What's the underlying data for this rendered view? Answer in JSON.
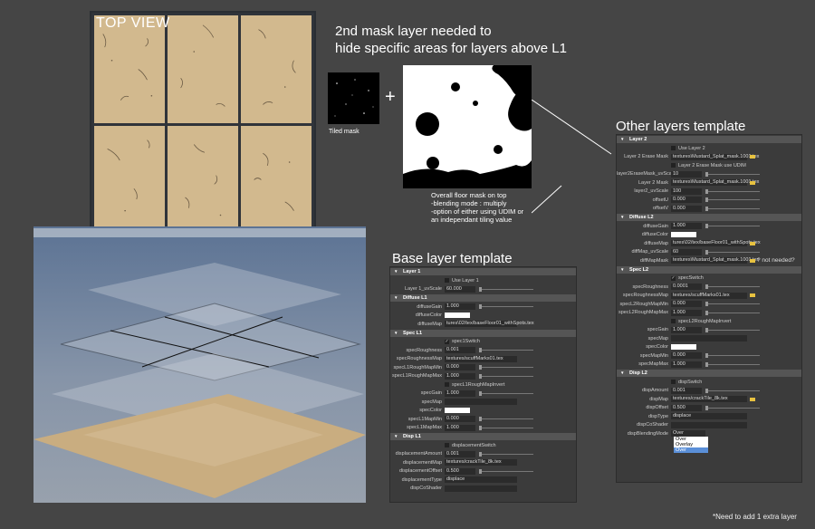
{
  "top_view": {
    "title": "TOP VIEW"
  },
  "mask_heading": {
    "line1": "2nd mask layer needed to",
    "line2": "hide specific areas for layers above L1"
  },
  "tiled_mask_label": "Tiled mask",
  "plus_sign": "+",
  "floor_caption": {
    "line1": "Overall floor mask on top",
    "line2": "-blending mode : multiply",
    "line3": "-option of either using UDIM or",
    "line4": "an independant tiling value"
  },
  "base_template": {
    "title": "Base layer template",
    "sections": [
      {
        "header": "Layer 1",
        "use_label": "Use Layer 1",
        "uv_label": "Layer 1_uvScale",
        "uv_value": "60.000"
      },
      {
        "header": "Diffuse L1",
        "gain_label": "diffuseGain",
        "gain_value": "1.000",
        "color_label": "diffuseColor",
        "map_label": "diffuseMap",
        "map_value": "tures\\02/tex/baseFloor01_withSpots.tex"
      },
      {
        "header": "Spec L1",
        "switch_label": "spec1Switch",
        "rough_label": "specRoughness",
        "rough_value": "0.001",
        "roughmap_label": "specRoughnessMap",
        "roughmap_value": "textures/scuffMarks01.tex",
        "rmin_label": "specL1RoughMapMin",
        "rmin_value": "0.000",
        "rmax_label": "specL1RoughMapMax",
        "rmax_value": "1.000",
        "invert_label": "specL1RoughMapInvert",
        "gain_label": "specGain",
        "gain_value": "1.000",
        "map_label": "specMap",
        "color_label": "specColor",
        "mmin_label": "specL1MapMin",
        "mmin_value": "0.000",
        "mmax_label": "specL1MapMax",
        "mmax_value": "1.000"
      },
      {
        "header": "Disp L1",
        "switch_label": "displacementSwitch",
        "amount_label": "displacementAmount",
        "amount_value": "0.001",
        "map_label": "displacementMap",
        "map_value": "textures/crackTile_8k.tex",
        "offset_label": "displacementOffset",
        "offset_value": "0.500",
        "type_label": "displacementType",
        "type_value": "displace",
        "shader_label": "dispCoShader"
      }
    ]
  },
  "other_template": {
    "title": "Other layers template",
    "layer": {
      "header": "Layer 2",
      "use_label": "Use Layer 2",
      "erase_label": "Layer 2 Erase Mask",
      "erase_value": "textures\\Mustard_Splat_mask.1001.tex",
      "udim_label": "Layer 2 Erase Mask use UDIM",
      "uv_label": "layer2EraseMask_uvScale",
      "uv_value": "10",
      "map_label": "Layer 2 Mask",
      "map_value": "textures\\Mustard_Splat_mask.1001.tex",
      "uvs_label": "layer2_uvScale",
      "uvs_value": "100",
      "ou_label": "offsetU",
      "ou_value": "0.000",
      "ov_label": "offsetV",
      "ov_value": "0.000"
    },
    "diffuse": {
      "header": "Diffuse L2",
      "gain_label": "diffuseGain",
      "gain_value": "1.000",
      "color_label": "diffuseColor",
      "map_label": "diffuseMap",
      "map_value": "tures\\02/tex/baseFloor01_withSpots.tex",
      "uv_label": "diffMap_uvScale",
      "uv_value": "60",
      "mask_label": "diffMapMask",
      "mask_value": "textures\\Mustard_Splat_mask.1001.tex",
      "note": "? not needed?"
    },
    "spec": {
      "header": "Spec L2",
      "switch_label": "specSwitch",
      "rough_label": "specRoughness",
      "rough_value": "0.0001",
      "roughmap_label": "specRoughnessMap",
      "roughmap_value": "textures/scuffMarks01.tex",
      "rmin_label": "specL2RoughMapMin",
      "rmin_value": "0.000",
      "rmax_label": "specL2RoughMapMax",
      "rmax_value": "1.000",
      "invert_label": "specL2RoughMapInvert",
      "gain_label": "specGain",
      "gain_value": "1.000",
      "map_label": "specMap",
      "color_label": "specColor",
      "mmin_label": "specMapMin",
      "mmin_value": "0.000",
      "mmax_label": "specMapMax",
      "mmax_value": "1.000"
    },
    "disp": {
      "header": "Disp L2",
      "switch_label": "dispSwitch",
      "amount_label": "dispAmount",
      "amount_value": "0.001",
      "map_label": "dispMap",
      "map_value": "textures/crackTile_8k.tex",
      "offset_label": "dispOffset",
      "offset_value": "0.500",
      "type_label": "dispType",
      "type_value": "displace",
      "shader_label": "dispCoShader",
      "blend_label": "dispBlendingMode",
      "blend_value": "Over",
      "options": [
        "Over",
        "Overlay",
        "Over"
      ]
    }
  },
  "footnote": "*Need to add 1 extra layer",
  "colors": {
    "sand": "#d2b98e",
    "panel": "#3b3b3b",
    "section": "#555555",
    "background": "#454545",
    "folder": "#e8c240"
  }
}
